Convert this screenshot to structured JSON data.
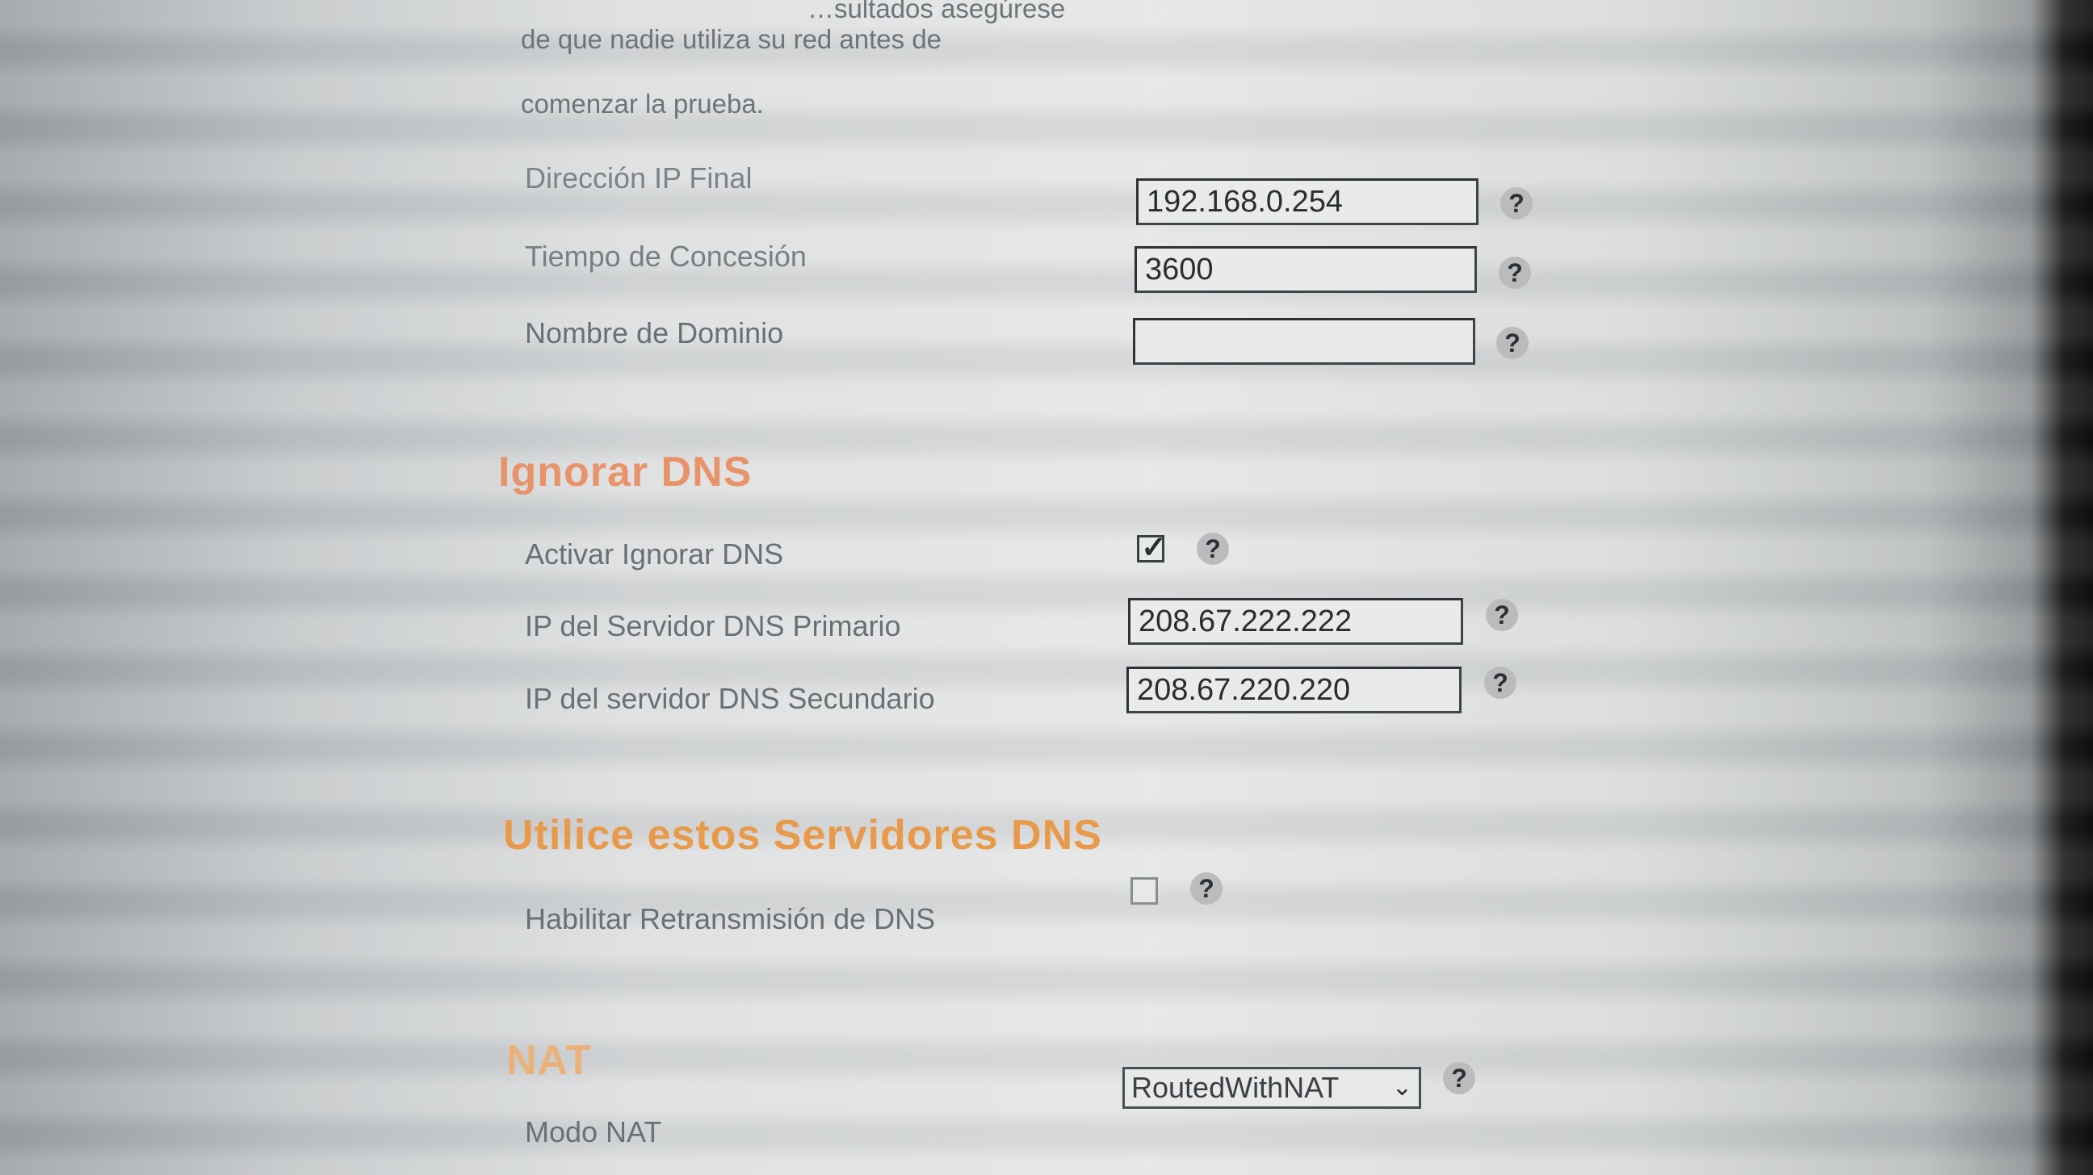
{
  "intro": {
    "line1": "…sultados asegúrese",
    "line2": "de que nadie utiliza su red antes de",
    "line3": "comenzar la prueba."
  },
  "dhcp": {
    "end_ip_label": "Dirección IP Final",
    "end_ip_value": "192.168.0.254",
    "lease_label": "Tiempo de Concesión",
    "lease_value": "3600",
    "domain_label": "Nombre de Dominio",
    "domain_value": ""
  },
  "ignore_dns": {
    "heading": "Ignorar DNS",
    "enable_label": "Activar Ignorar DNS",
    "enable_checked": true,
    "primary_label": "IP del Servidor DNS Primario",
    "primary_value": "208.67.222.222",
    "secondary_label": "IP del servidor DNS Secundario",
    "secondary_value": "208.67.220.220"
  },
  "use_dns": {
    "heading": "Utilice estos Servidores DNS",
    "relay_label": "Habilitar Retransmisión de DNS",
    "relay_checked": false
  },
  "nat": {
    "heading": "NAT",
    "mode_label": "Modo NAT",
    "mode_value": "RoutedWithNAT"
  },
  "help_glyph": "?",
  "icons": {
    "help": "question-circle-icon",
    "dropdown": "chevron-down-icon",
    "check": "checkmark-icon"
  }
}
